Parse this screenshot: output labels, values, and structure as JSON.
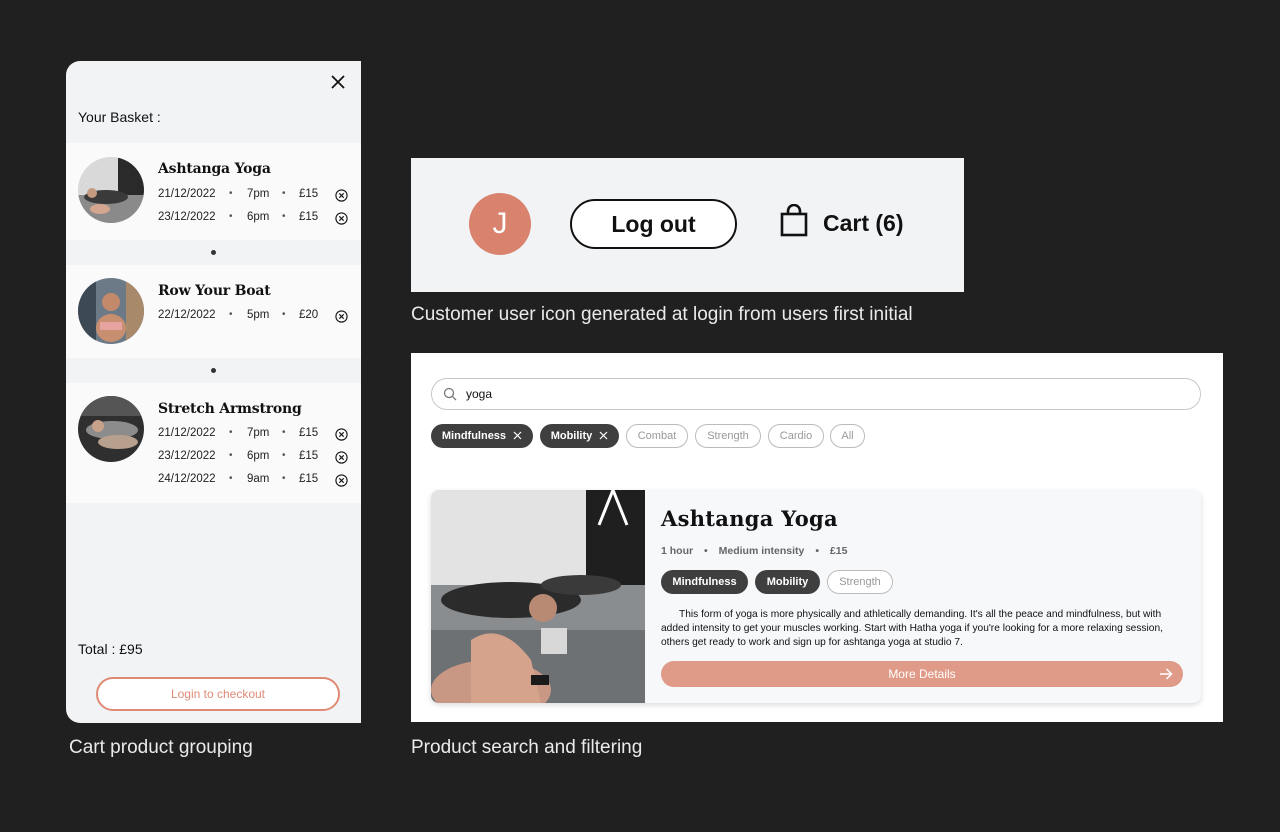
{
  "basket": {
    "title": "Your Basket :",
    "groups": [
      {
        "name": "Ashtanga Yoga",
        "slots": [
          {
            "date": "21/12/2022",
            "time": "7pm",
            "price": "£15"
          },
          {
            "date": "23/12/2022",
            "time": "6pm",
            "price": "£15"
          }
        ]
      },
      {
        "name": "Row Your Boat",
        "slots": [
          {
            "date": "22/12/2022",
            "time": "5pm",
            "price": "£20"
          }
        ]
      },
      {
        "name": "Stretch Armstrong",
        "slots": [
          {
            "date": "21/12/2022",
            "time": "7pm",
            "price": "£15"
          },
          {
            "date": "23/12/2022",
            "time": "6pm",
            "price": "£15"
          },
          {
            "date": "24/12/2022",
            "time": "9am",
            "price": "£15"
          }
        ]
      }
    ],
    "separator": "•",
    "total": "Total : £95",
    "checkout_label": "Login to checkout"
  },
  "header": {
    "avatar_initial": "J",
    "logout_label": "Log out",
    "cart_label": "Cart (6)"
  },
  "search": {
    "query": "yoga",
    "filters": [
      {
        "label": "Mindfulness",
        "active": true
      },
      {
        "label": "Mobility",
        "active": true
      },
      {
        "label": "Combat",
        "active": false
      },
      {
        "label": "Strength",
        "active": false
      },
      {
        "label": "Cardio",
        "active": false
      },
      {
        "label": "All",
        "active": false
      }
    ]
  },
  "product_card": {
    "title": "Ashtanga Yoga",
    "duration": "1 hour",
    "intensity": "Medium intensity",
    "price": "£15",
    "meta_separator": "•",
    "tags": [
      {
        "label": "Mindfulness",
        "active": true
      },
      {
        "label": "Mobility",
        "active": true
      },
      {
        "label": "Strength",
        "active": false
      }
    ],
    "description": "This form of yoga is more physically and athletically demanding. It's all the peace and mindfulness, but with added intensity to get your muscles working. Start with Hatha yoga if you're looking for a more relaxing session, others get ready to work and sign up for ashtanga yoga at studio 7.",
    "button_label": "More Details"
  },
  "captions": {
    "cart": "Cart product grouping",
    "icon": "Customer user icon generated at login from users first initial",
    "search": "Product search and filtering"
  },
  "colors": {
    "background": "#202020",
    "accent": "#de8a75",
    "chip_active": "#3f3f3f"
  }
}
